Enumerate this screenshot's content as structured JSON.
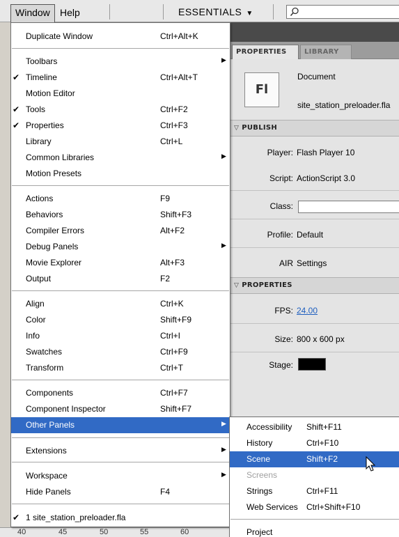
{
  "menubar": {
    "window_label": "Window",
    "help_label": "Help",
    "workspace_label": "ESSENTIALS",
    "workspace_caret": "▼",
    "search_icon": "magnifier-icon"
  },
  "panel": {
    "tabs": [
      "PROPERTIES",
      "LIBRARY"
    ],
    "doc_icon_text": "Fl",
    "doc_type": "Document",
    "doc_name": "site_station_preloader.fla",
    "publish": {
      "header": "PUBLISH",
      "player_label": "Player:",
      "player_value": "Flash Player 10",
      "script_label": "Script:",
      "script_value": "ActionScript 3.0",
      "class_label": "Class:",
      "class_value": "",
      "profile_label": "Profile:",
      "profile_value": "Default",
      "air_label": "AIR",
      "air_value": "Settings"
    },
    "properties": {
      "header": "PROPERTIES",
      "fps_label": "FPS:",
      "fps_value": "24.00",
      "size_label": "Size:",
      "size_value": "800 x 600 px",
      "stage_label": "Stage:",
      "stage_color": "#000000"
    }
  },
  "ruler": [
    "40",
    "45",
    "50",
    "55",
    "60"
  ],
  "menu": {
    "items": [
      {
        "label": "Duplicate Window",
        "shortcut": "Ctrl+Alt+K",
        "checked": false,
        "submenu": false
      },
      {
        "label": "Toolbars",
        "shortcut": "",
        "checked": false,
        "submenu": true
      },
      {
        "label": "Timeline",
        "shortcut": "Ctrl+Alt+T",
        "checked": true,
        "submenu": false
      },
      {
        "label": "Motion Editor",
        "shortcut": "",
        "checked": false,
        "submenu": false
      },
      {
        "label": "Tools",
        "shortcut": "Ctrl+F2",
        "checked": true,
        "submenu": false
      },
      {
        "label": "Properties",
        "shortcut": "Ctrl+F3",
        "checked": true,
        "submenu": false
      },
      {
        "label": "Library",
        "shortcut": "Ctrl+L",
        "checked": false,
        "submenu": false
      },
      {
        "label": "Common Libraries",
        "shortcut": "",
        "checked": false,
        "submenu": true
      },
      {
        "label": "Motion Presets",
        "shortcut": "",
        "checked": false,
        "submenu": false
      },
      {
        "label": "Actions",
        "shortcut": "F9",
        "checked": false,
        "submenu": false
      },
      {
        "label": "Behaviors",
        "shortcut": "Shift+F3",
        "checked": false,
        "submenu": false
      },
      {
        "label": "Compiler Errors",
        "shortcut": "Alt+F2",
        "checked": false,
        "submenu": false
      },
      {
        "label": "Debug Panels",
        "shortcut": "",
        "checked": false,
        "submenu": true
      },
      {
        "label": "Movie Explorer",
        "shortcut": "Alt+F3",
        "checked": false,
        "submenu": false
      },
      {
        "label": "Output",
        "shortcut": "F2",
        "checked": false,
        "submenu": false
      },
      {
        "label": "Align",
        "shortcut": "Ctrl+K",
        "checked": false,
        "submenu": false
      },
      {
        "label": "Color",
        "shortcut": "Shift+F9",
        "checked": false,
        "submenu": false
      },
      {
        "label": "Info",
        "shortcut": "Ctrl+I",
        "checked": false,
        "submenu": false
      },
      {
        "label": "Swatches",
        "shortcut": "Ctrl+F9",
        "checked": false,
        "submenu": false
      },
      {
        "label": "Transform",
        "shortcut": "Ctrl+T",
        "checked": false,
        "submenu": false
      },
      {
        "label": "Components",
        "shortcut": "Ctrl+F7",
        "checked": false,
        "submenu": false
      },
      {
        "label": "Component Inspector",
        "shortcut": "Shift+F7",
        "checked": false,
        "submenu": false
      },
      {
        "label": "Other Panels",
        "shortcut": "",
        "checked": false,
        "submenu": true,
        "highlighted": true
      },
      {
        "label": "Extensions",
        "shortcut": "",
        "checked": false,
        "submenu": true
      },
      {
        "label": "Workspace",
        "shortcut": "",
        "checked": false,
        "submenu": true
      },
      {
        "label": "Hide Panels",
        "shortcut": "F4",
        "checked": false,
        "submenu": false
      },
      {
        "label": "1 site_station_preloader.fla",
        "shortcut": "",
        "checked": true,
        "submenu": false
      }
    ]
  },
  "submenu": {
    "items": [
      {
        "label": "Accessibility",
        "shortcut": "Shift+F11",
        "disabled": false
      },
      {
        "label": "History",
        "shortcut": "Ctrl+F10",
        "disabled": false
      },
      {
        "label": "Scene",
        "shortcut": "Shift+F2",
        "disabled": false,
        "highlighted": true
      },
      {
        "label": "Screens",
        "shortcut": "",
        "disabled": true
      },
      {
        "label": "Strings",
        "shortcut": "Ctrl+F11",
        "disabled": false
      },
      {
        "label": "Web Services",
        "shortcut": "Ctrl+Shift+F10",
        "disabled": false
      },
      {
        "label": "Project",
        "shortcut": "",
        "disabled": false
      }
    ]
  },
  "colors": {
    "highlight": "#316ac5",
    "link": "#1f5fbf"
  }
}
